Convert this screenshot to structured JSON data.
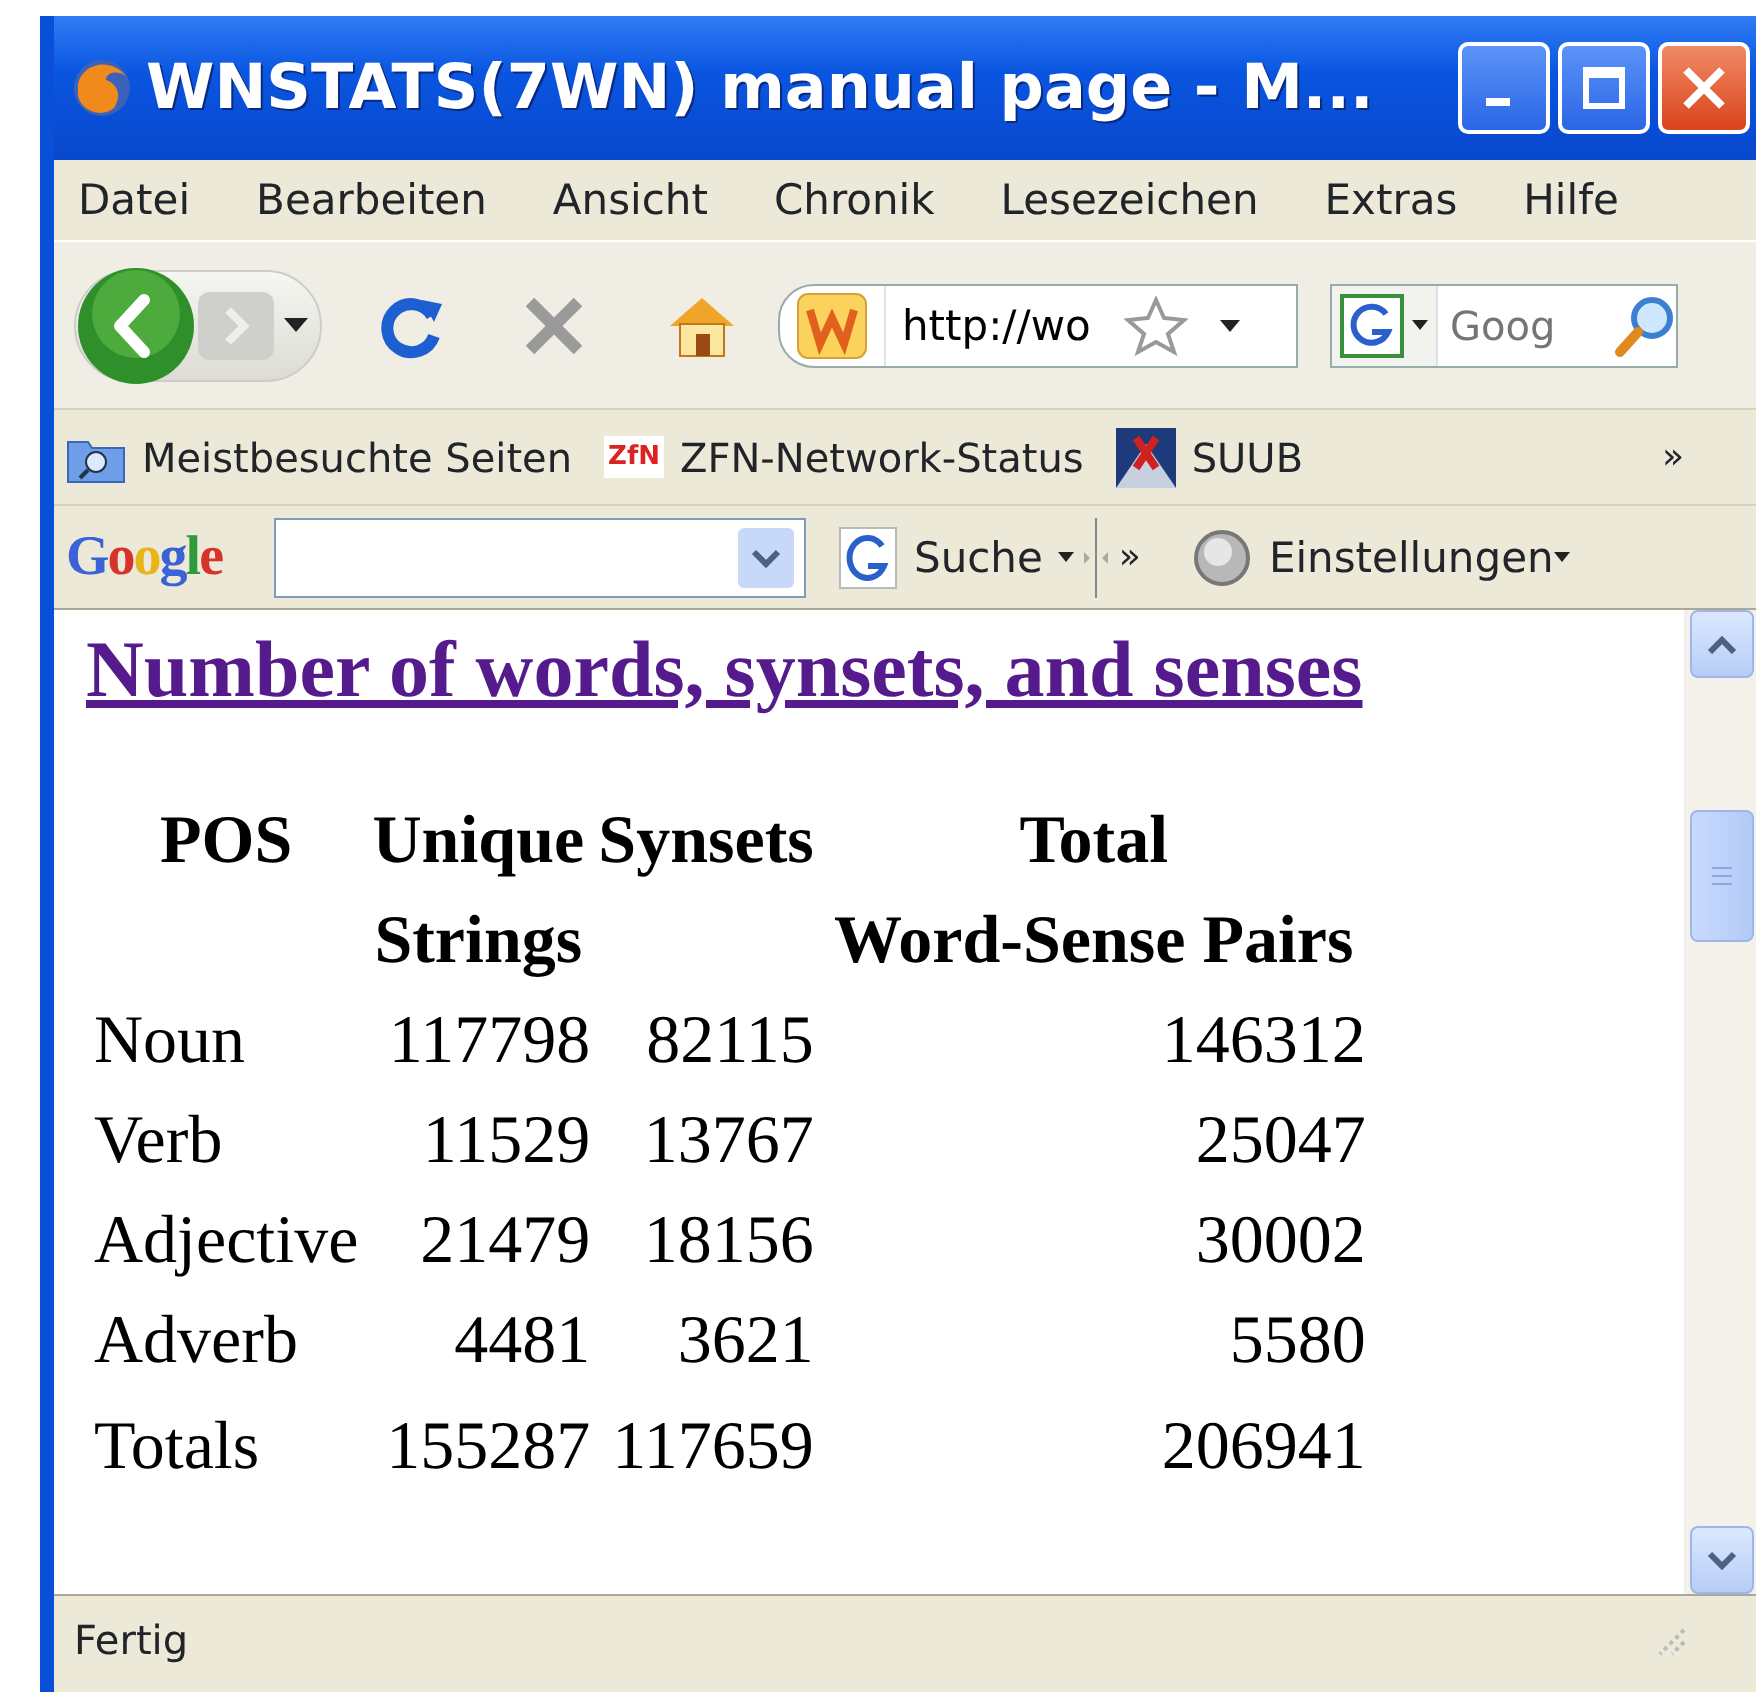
{
  "window": {
    "title": "WNSTATS(7WN) manual page - M..."
  },
  "menu": [
    "Datei",
    "Bearbeiten",
    "Ansicht",
    "Chronik",
    "Lesezeichen",
    "Extras",
    "Hilfe"
  ],
  "navigation": {
    "address": "http://wo",
    "search_placeholder": "Goog"
  },
  "bookmarks": [
    {
      "kind": "folder",
      "label": "Meistbesuchte Seiten"
    },
    {
      "kind": "zfn",
      "label": "ZFN-Network-Status",
      "favicon": "ZfN"
    },
    {
      "kind": "suub",
      "label": "SUUB"
    }
  ],
  "bookmarks_more": "»",
  "google_bar": {
    "logo": "Google",
    "search_label": "Suche",
    "more": "»",
    "settings": "Einstellungen"
  },
  "content": {
    "heading": "Number of words, synsets, and senses",
    "table": {
      "columns": [
        {
          "lines": [
            "POS"
          ]
        },
        {
          "lines": [
            "Unique",
            "Strings"
          ]
        },
        {
          "lines": [
            "Synsets"
          ]
        },
        {
          "lines": [
            "Total",
            "Word-Sense Pairs"
          ]
        }
      ],
      "rows": [
        [
          "Noun",
          "117798",
          "82115",
          "146312"
        ],
        [
          "Verb",
          "11529",
          "13767",
          "25047"
        ],
        [
          "Adjective",
          "21479",
          "18156",
          "30002"
        ],
        [
          "Adverb",
          "4481",
          "3621",
          "5580"
        ],
        [
          "Totals",
          "155287",
          "117659",
          "206941"
        ]
      ]
    }
  },
  "status_bar": "Fertig"
}
